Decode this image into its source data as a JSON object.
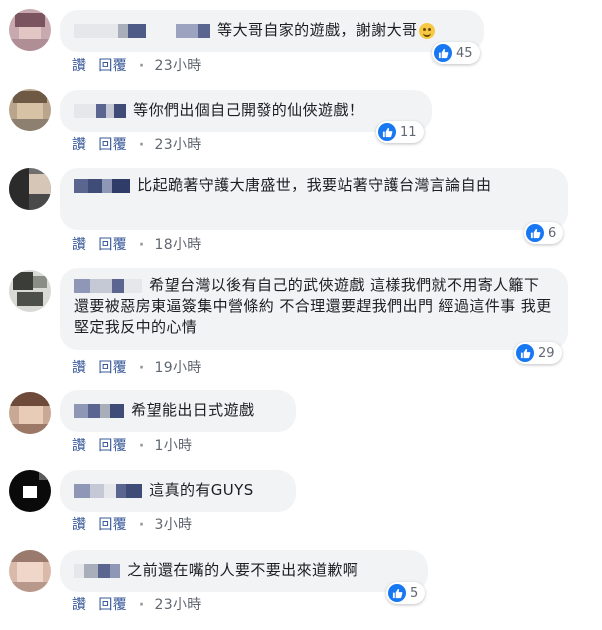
{
  "actions": {
    "like": "讚",
    "reply": "回覆",
    "separator": "·"
  },
  "colors": {
    "bubble": "#f2f3f5",
    "link": "#385898",
    "like_blue": "#1877f2"
  },
  "comments": [
    {
      "text": "等大哥自家的遊戲，謝謝大哥",
      "emoji": "smiling-face",
      "likes": "45",
      "time": "23小時"
    },
    {
      "text": "等你們出個自己開發的仙俠遊戲！",
      "likes": "11",
      "time": "23小時"
    },
    {
      "text": "比起跪著守護大唐盛世，我要站著守護台灣言論自由",
      "likes": "6",
      "time": "18小時"
    },
    {
      "text": "希望台灣以後有自己的武俠遊戲 這樣我們就不用寄人籬下 還要被惡房東逼簽集中營條約 不合理還要趕我們出門 經過這件事 我更堅定我反中的心情",
      "likes": "29",
      "time": "19小時"
    },
    {
      "text": "希望能出日式遊戲",
      "time": "1小時"
    },
    {
      "text": "這真的有GUYS",
      "time": "3小時"
    },
    {
      "text": "之前還在嘴的人要不要出來道歉啊",
      "likes": "5",
      "time": "23小時"
    }
  ]
}
